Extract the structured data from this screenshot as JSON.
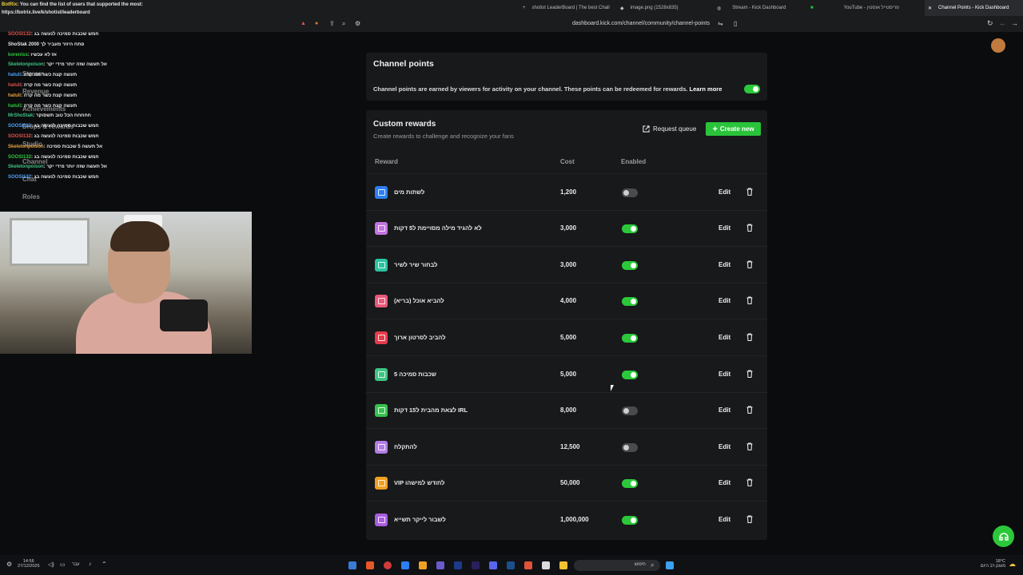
{
  "browser": {
    "tabs": [
      {
        "label": "shotist LeaderBoard | The best Chall"
      },
      {
        "label": "image.png (1528x835)"
      },
      {
        "label": "Stream - Kick Dashboard"
      },
      {
        "label": "YouTube - פריסטייל אוסטין"
      },
      {
        "label": "Channel Points - Kick Dashboard"
      }
    ],
    "url": "dashboard.kick.com/channel/community/channel-points"
  },
  "overlay": {
    "bot_line_user": "BotRix",
    "bot_line_text": ": You can find the list of users that supported the most:",
    "bot_line_link": "https://botrix.live/k/shotist/leaderboard",
    "chat": [
      {
        "user": "SOOSI132",
        "text": ": חמש שכבות סמיכה לנעשה בג"
      },
      {
        "user": "",
        "text": "ShoStak 2000 פתח היוזר מעביר לך"
      },
      {
        "user": "koreniss",
        "text": ": אז לא עכשיו"
      },
      {
        "user": "Skeletonpoison",
        "text": ": אל תעשה שזה יותר מידי יקר"
      },
      {
        "user": "hatuli",
        "text": ": תעשה קצת כשר מה קרה"
      },
      {
        "user": "hatuli",
        "text": ": תעשה קצת כשר מה קרה"
      },
      {
        "user": "hatuli",
        "text": ": תעשה קצת כשר מה קרה"
      },
      {
        "user": "hatuli",
        "text": ": תעשה קצת כשר מה קרה"
      },
      {
        "user": "MrShoStak",
        "text": ": חחחחח הכל טוב תשסוקר"
      },
      {
        "user": "SOOSI132",
        "text": ": חמש שכבות סמיכה לנעשה בג"
      },
      {
        "user": "SOOSI132",
        "text": ": חמש שכבות סמיכה לנעשה בג"
      },
      {
        "user": "Skeletonpoison",
        "text": ": אל תעשה 5 שכבות סמיכה"
      },
      {
        "user": "SOOSI132",
        "text": ": חמש שכבות סמיכה לנעשה בג"
      },
      {
        "user": "Skeletonpoison",
        "text": ": אל תעשה שזה יותר מידי יקר"
      },
      {
        "user": "SOOSI132",
        "text": ": חמש שכבות סמיכה לנעשה בג"
      }
    ],
    "nav_ghost": [
      "Stream",
      "Revenue",
      "Achievements",
      "Drops & rewards",
      "Studio",
      "Channel",
      "Chat",
      "Roles"
    ]
  },
  "page": {
    "channel_points_title": "Channel points",
    "channel_points_desc": "Channel points are earned by viewers for activity on your channel. These points can be redeemed for rewards.",
    "learn_more": "Learn more",
    "channel_points_enabled": true,
    "custom_rewards_title": "Custom rewards",
    "custom_rewards_sub": "Create rewards to challenge and recognize your fans",
    "request_queue": "Request queue",
    "create_new": "Create new",
    "col_reward": "Reward",
    "col_cost": "Cost",
    "col_enabled": "Enabled",
    "edit_label": "Edit"
  },
  "rewards": [
    {
      "name": "לשתות מים",
      "cost": "1,200",
      "enabled": false,
      "color": "#2d7ff2"
    },
    {
      "name": "לא להגיד מילה מסויימת ל5 דקות",
      "cost": "3,000",
      "enabled": true,
      "color": "#c274e0"
    },
    {
      "name": "לבחור שיר לשיר",
      "cost": "3,000",
      "enabled": true,
      "color": "#2bc3a0"
    },
    {
      "name": "להביא אוכל (בריא)",
      "cost": "4,000",
      "enabled": true,
      "color": "#e8597a"
    },
    {
      "name": "להביב לסרטון ארוך",
      "cost": "5,000",
      "enabled": true,
      "color": "#e53b4b"
    },
    {
      "name": "5 שכבות סמיכה",
      "cost": "5,000",
      "enabled": true,
      "color": "#3ec483"
    },
    {
      "name": "לצאת מהבית ל15 דקות IRL",
      "cost": "8,000",
      "enabled": false,
      "color": "#36c24f"
    },
    {
      "name": "להתקלח",
      "cost": "12,500",
      "enabled": false,
      "color": "#b27de6"
    },
    {
      "name": "VIP לחודש למישהו",
      "cost": "50,000",
      "enabled": true,
      "color": "#f0a020"
    },
    {
      "name": "לשבור לייקר תשייא",
      "cost": "1,000,000",
      "enabled": true,
      "color": "#a85ee0"
    }
  ],
  "taskbar": {
    "time": "14:56",
    "date": "27/12/2025",
    "lang": "עבר",
    "search": "חיפוש",
    "weather": "18°C",
    "weather_desc": "מעונן רב היום"
  },
  "colors": {
    "accent": "#2bc93a",
    "bg": "#0b0c0d",
    "card": "#18191b"
  }
}
